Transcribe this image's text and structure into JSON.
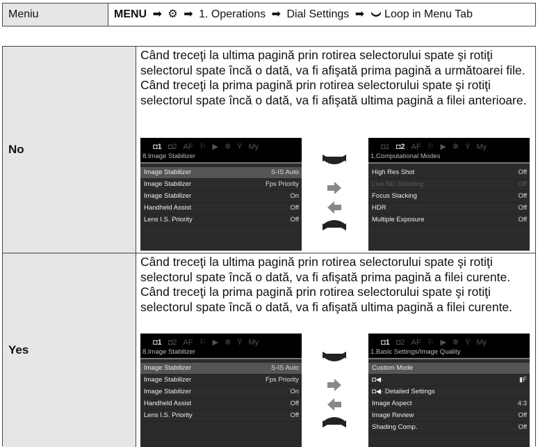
{
  "menu_path": {
    "label": "Meniu",
    "menu": "MENU",
    "step_gear": "⚙",
    "step1": "1. Operations",
    "step2": "Dial Settings",
    "step3": "Loop in Menu Tab",
    "arrow": "➡",
    "loop_glyph": "❤"
  },
  "rows": {
    "no": {
      "label": "No",
      "p1": "Când treceţi la ultima pagină prin rotirea selectorului spate şi rotiţi selectorul spate încă o dată, va fi afişată prima pagină a următoarei file.",
      "p2": "Când treceţi la prima pagină prin rotirea selectorului spate şi rotiţi selectorul spate încă o dată, va fi afişată ultima pagină a filei anterioare."
    },
    "yes": {
      "label": "Yes",
      "p1": "Când treceţi la ultima pagină prin rotirea selectorului spate şi rotiţi selectorul spate încă o dată, va fi afişată prima pagină a filei curente.",
      "p2": "Când treceţi la prima pagină prin rotirea selectorului spate şi rotiţi selectorul spate încă o dată, va fi afişată ultima pagină a filei curente."
    }
  },
  "screens": {
    "tabs": [
      "◘1",
      "◘2",
      "AF",
      "⚐",
      "▶",
      "✲",
      "Ÿ",
      "My"
    ],
    "image_stabilizer": {
      "subtitle": "8.Image Stabilizer",
      "items": [
        {
          "label": "Image Stabilizer",
          "value": "S-IS Auto"
        },
        {
          "label": "Image Stabilizer",
          "value": "Fps Priority"
        },
        {
          "label": "Image Stabilizer",
          "value": "On"
        },
        {
          "label": "Handheld Assist",
          "value": "Off"
        },
        {
          "label": "Lens I.S. Priority",
          "value": "Off"
        }
      ]
    },
    "computational": {
      "subtitle": "1.Computational Modes",
      "items": [
        {
          "label": "High Res Shot",
          "value": "Off"
        },
        {
          "label": "Live ND Shooting",
          "value": "Off"
        },
        {
          "label": "Focus Stacking",
          "value": "Off"
        },
        {
          "label": "HDR",
          "value": "Off"
        },
        {
          "label": "Multiple Exposure",
          "value": "Off"
        }
      ]
    },
    "basic": {
      "subtitle": "1.Basic Settings/Image Quality",
      "items": [
        {
          "label": "Custom Mode",
          "value": ""
        },
        {
          "label": "◘◀·",
          "value": "▮F"
        },
        {
          "label": "◘◀· Detailed Settings",
          "value": ""
        },
        {
          "label": "Image Aspect",
          "value": "4:3"
        },
        {
          "label": "Image Review",
          "value": "Off"
        },
        {
          "label": "Shading Comp.",
          "value": "Off"
        }
      ]
    }
  }
}
